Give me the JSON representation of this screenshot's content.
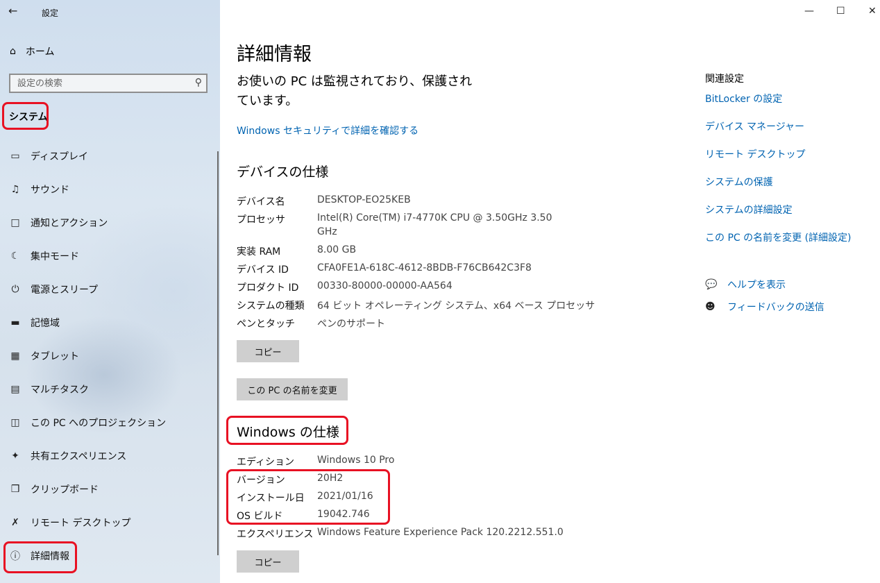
{
  "window": {
    "title": "設定"
  },
  "sidebar": {
    "home": "ホーム",
    "search_placeholder": "設定の検索",
    "section": "システム",
    "items": [
      {
        "label": "ディスプレイ",
        "icon": "display-icon"
      },
      {
        "label": "サウンド",
        "icon": "sound-icon"
      },
      {
        "label": "通知とアクション",
        "icon": "notification-icon"
      },
      {
        "label": "集中モード",
        "icon": "moon-icon"
      },
      {
        "label": "電源とスリープ",
        "icon": "power-icon"
      },
      {
        "label": "記憶域",
        "icon": "storage-icon"
      },
      {
        "label": "タブレット",
        "icon": "tablet-icon"
      },
      {
        "label": "マルチタスク",
        "icon": "multitask-icon"
      },
      {
        "label": "この PC へのプロジェクション",
        "icon": "projection-icon"
      },
      {
        "label": "共有エクスペリエンス",
        "icon": "share-icon"
      },
      {
        "label": "クリップボード",
        "icon": "clipboard-icon"
      },
      {
        "label": "リモート デスクトップ",
        "icon": "remote-icon"
      },
      {
        "label": "詳細情報",
        "icon": "info-icon"
      }
    ]
  },
  "main": {
    "title": "詳細情報",
    "status": "お使いの PC は監視されており、保護されています。",
    "security_link": "Windows セキュリティで詳細を確認する",
    "device_heading": "デバイスの仕様",
    "device_specs": [
      {
        "label": "デバイス名",
        "value": "DESKTOP-EO25KEB"
      },
      {
        "label": "プロセッサ",
        "value": "Intel(R) Core(TM) i7-4770K CPU @ 3.50GHz   3.50",
        "value2": "GHz"
      },
      {
        "label": "実装 RAM",
        "value": "8.00 GB"
      },
      {
        "label": "デバイス ID",
        "value": "CFA0FE1A-618C-4612-8BDB-F76CB642C3F8"
      },
      {
        "label": "プロダクト ID",
        "value": "00330-80000-00000-AA564"
      },
      {
        "label": "システムの種類",
        "value": "64 ビット オペレーティング システム、x64 ベース プロセッサ"
      },
      {
        "label": "ペンとタッチ",
        "value": "ペンのサポート"
      }
    ],
    "copy_label": "コピー",
    "rename_label": "この PC の名前を変更",
    "windows_heading": "Windows の仕様",
    "windows_specs": [
      {
        "label": "エディション",
        "value": "Windows 10 Pro"
      },
      {
        "label": "バージョン",
        "value": "20H2"
      },
      {
        "label": "インストール日",
        "value": "2021/01/16"
      },
      {
        "label": "OS ビルド",
        "value": "19042.746"
      },
      {
        "label": "エクスペリエンス",
        "value": "Windows Feature Experience Pack 120.2212.551.0"
      }
    ],
    "copy2_label": "コピー"
  },
  "related": {
    "title": "関連設定",
    "links": [
      "BitLocker の設定",
      "デバイス マネージャー",
      "リモート デスクトップ",
      "システムの保護",
      "システムの詳細設定",
      "この PC の名前を変更 (詳細設定)"
    ],
    "help": "ヘルプを表示",
    "feedback": "フィードバックの送信"
  },
  "colors": {
    "accent": "#0063b1",
    "highlight": "#e81123",
    "button": "#cfcfcf"
  }
}
